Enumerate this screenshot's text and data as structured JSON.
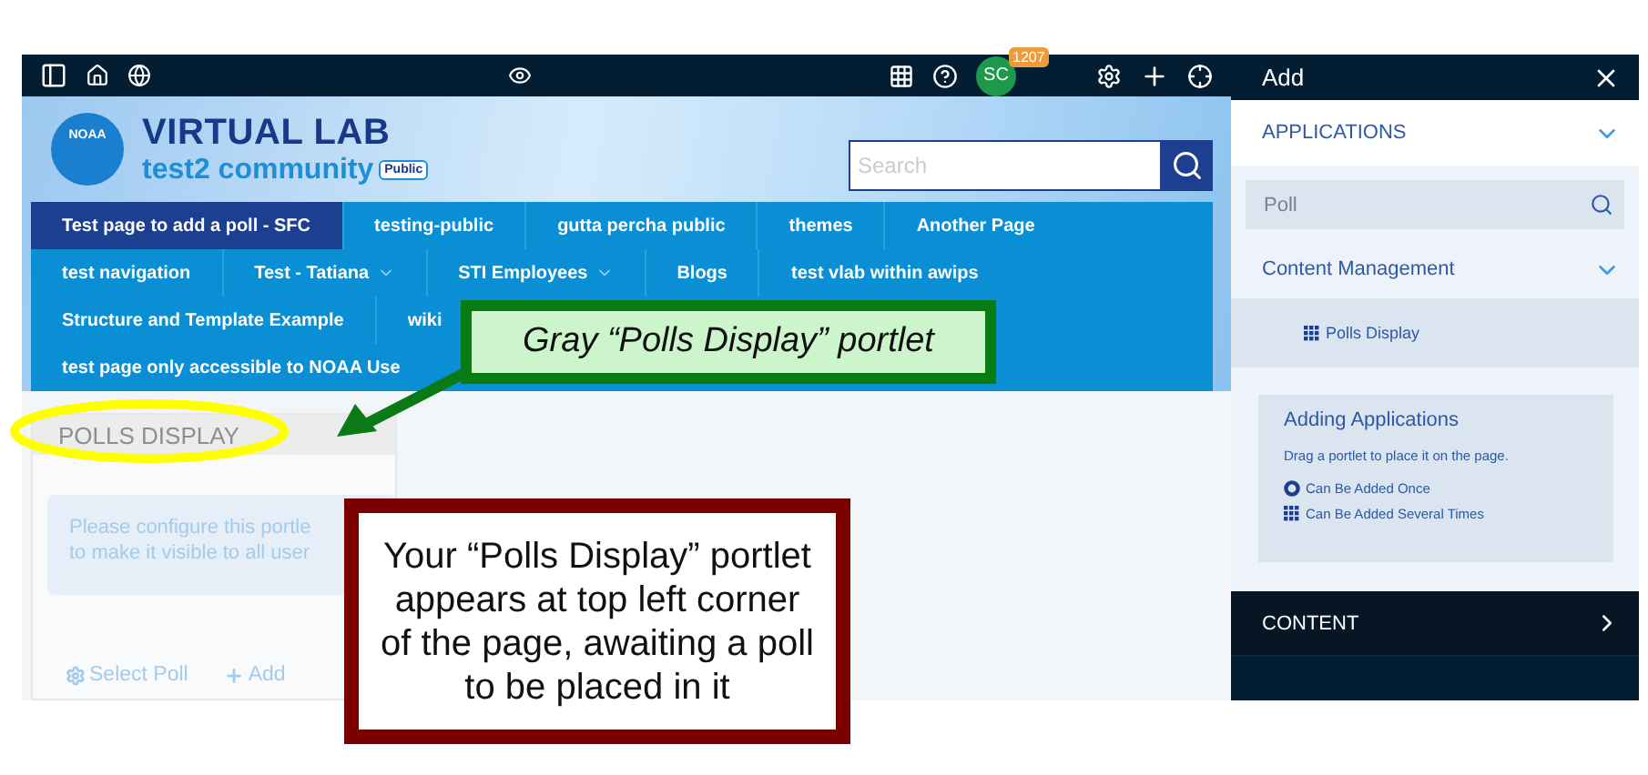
{
  "top_bar": {
    "avatar": "SC",
    "badge": "1207"
  },
  "site": {
    "logo_text": "NOAA",
    "title": "VIRTUAL LAB",
    "community": "test2 community",
    "tag": "Public",
    "search": {
      "placeholder": "Search"
    }
  },
  "nav_rows": [
    {
      "items": [
        {
          "label": "Test page to add a poll - SFC",
          "selected": true,
          "has_menu": false
        },
        {
          "label": "testing-public",
          "selected": false,
          "has_menu": false
        },
        {
          "label": "gutta percha public",
          "selected": false,
          "has_menu": false
        },
        {
          "label": "themes",
          "selected": false,
          "has_menu": false
        },
        {
          "label": "Another Page",
          "selected": false,
          "has_menu": false
        }
      ]
    },
    {
      "items": [
        {
          "label": "test navigation",
          "selected": false,
          "has_menu": false
        },
        {
          "label": "Test - Tatiana",
          "selected": false,
          "has_menu": true
        },
        {
          "label": "STI Employees",
          "selected": false,
          "has_menu": true
        },
        {
          "label": "Blogs",
          "selected": false,
          "has_menu": false
        },
        {
          "label": "test vlab within awips",
          "selected": false,
          "has_menu": false
        }
      ]
    },
    {
      "items": [
        {
          "label": "Structure and Template Example",
          "selected": false,
          "has_menu": false
        },
        {
          "label": "wiki",
          "selected": false,
          "has_menu": false
        }
      ]
    },
    {
      "items": [
        {
          "label": "test page only accessible to NOAA Use",
          "selected": false,
          "has_menu": false
        }
      ]
    }
  ],
  "portlet": {
    "title": "POLLS DISPLAY",
    "message_lines": [
      "Please configure this portle",
      "to make it visible to all user"
    ],
    "actions": [
      {
        "kind": "select",
        "label": "Select Poll"
      },
      {
        "kind": "add",
        "label": "Add"
      }
    ]
  },
  "panel": {
    "title": "Add",
    "applications": {
      "label": "APPLICATIONS",
      "expanded": true,
      "search": {
        "value": "Poll"
      },
      "categories": [
        {
          "label": "Content Management",
          "expanded": true,
          "items": [
            {
              "label": "Polls Display",
              "kind": "several",
              "selected": true
            }
          ]
        }
      ],
      "help": {
        "title": "Adding Applications",
        "text": "Drag a portlet to place it on the page.",
        "legend": [
          {
            "kind": "once",
            "label": "Can Be Added Once"
          },
          {
            "kind": "several",
            "label": "Can Be Added Several Times"
          }
        ]
      }
    },
    "content": {
      "label": "CONTENT",
      "expanded": false
    }
  },
  "callouts": [
    {
      "kind": "label",
      "text": "Gray “Polls Display” portlet"
    },
    {
      "kind": "note",
      "text": "Your “Polls Display” portlet appears at top left corner of the page, awaiting a poll to be placed in it"
    }
  ]
}
